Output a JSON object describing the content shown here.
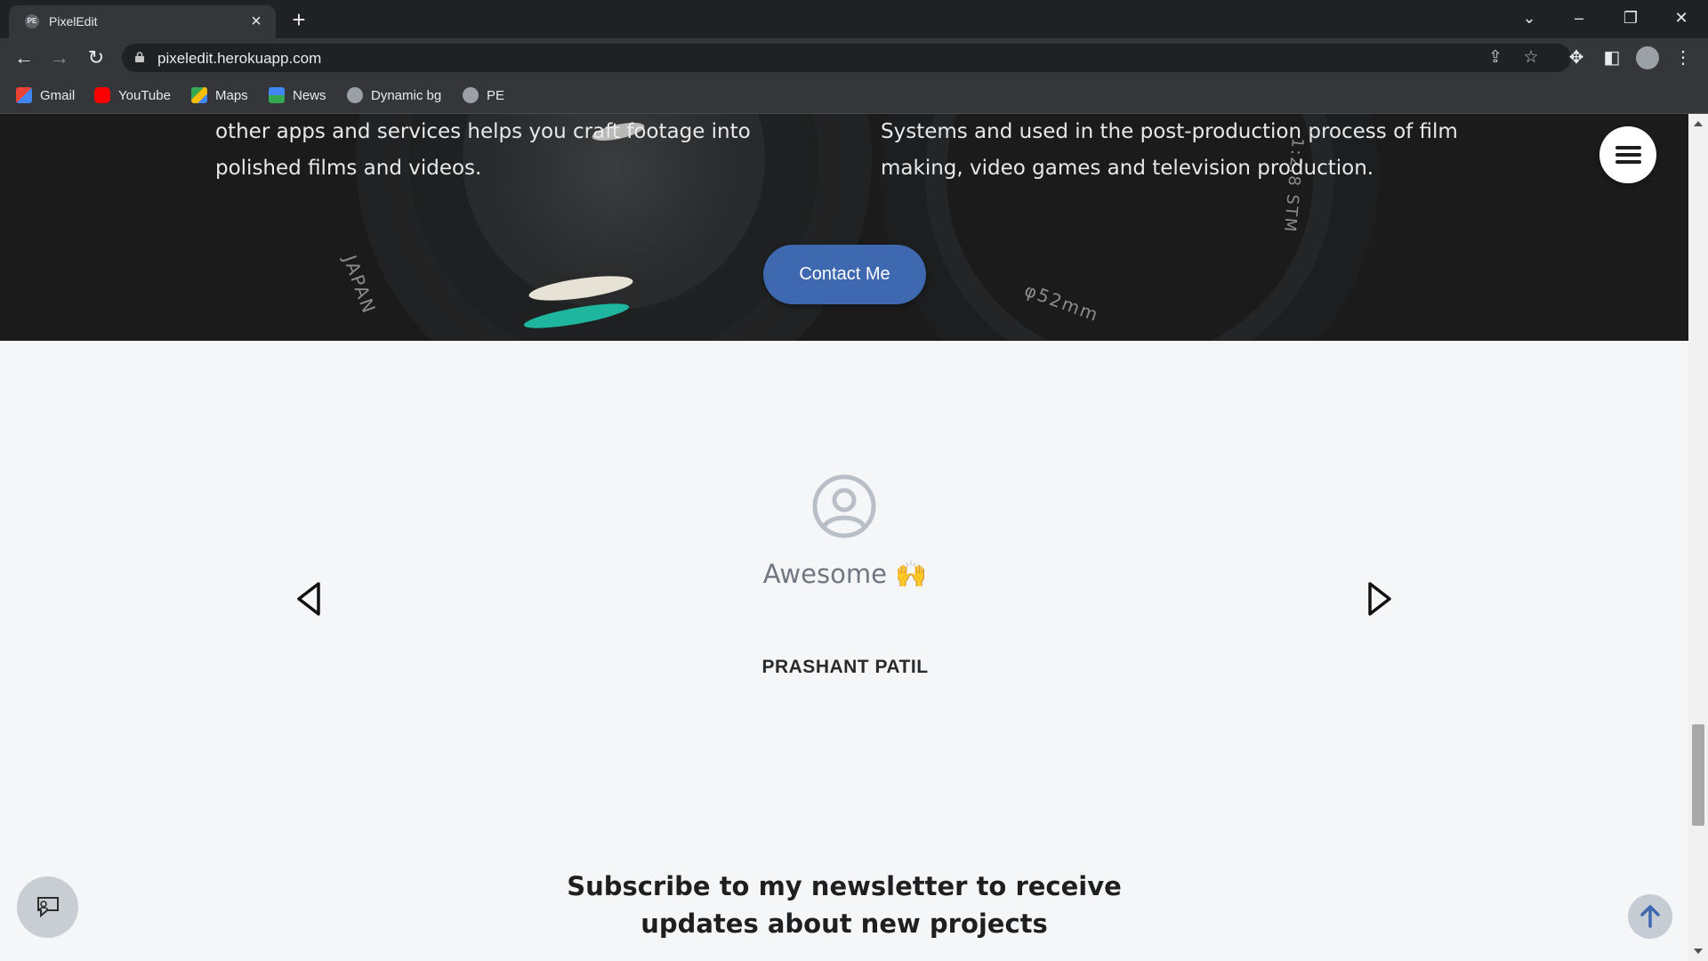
{
  "browser": {
    "tab_title": "PixelEdit",
    "tab_favicon_text": "PE",
    "url": "pixeledit.herokuapp.com",
    "bookmarks": [
      {
        "label": "Gmail",
        "icon": "gmail-icon"
      },
      {
        "label": "YouTube",
        "icon": "youtube-icon"
      },
      {
        "label": "Maps",
        "icon": "maps-icon"
      },
      {
        "label": "News",
        "icon": "news-icon"
      },
      {
        "label": "Dynamic bg",
        "icon": "globe-icon"
      },
      {
        "label": "PE",
        "icon": "globe-icon"
      }
    ]
  },
  "hero": {
    "left_paragraph": [
      "other apps and services helps you craft footage into",
      "polished films and videos."
    ],
    "right_paragraph": [
      "Systems and used in the post-production process of film",
      "making, video games and television production."
    ],
    "contact_button": "Contact Me",
    "lens_text_1": "JAPAN",
    "lens_text_2": "φ52mm",
    "lens_text_3": "1:2.8 STM"
  },
  "testimonial": {
    "quote": "Awesome 🙌",
    "author": "PRASHANT PATIL"
  },
  "newsletter": {
    "heading_line1": "Subscribe to my newsletter to receive",
    "heading_line2": "updates about new projects"
  },
  "colors": {
    "accent": "#3e68b0",
    "page_bg": "#f4f6f8",
    "hero_bg": "#1c1c1d"
  }
}
